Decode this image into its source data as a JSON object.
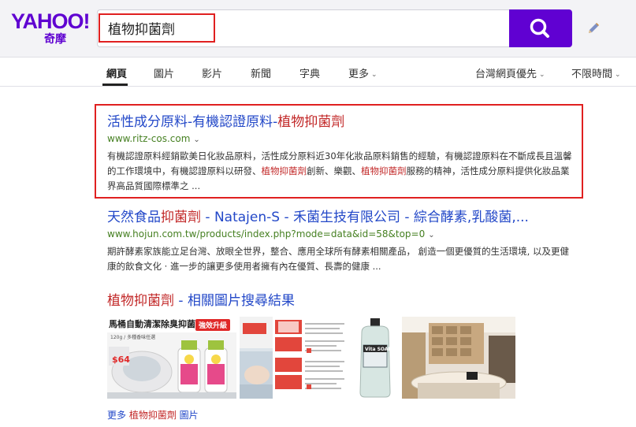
{
  "logo": {
    "main": "YAHOO!",
    "sub": "奇摩"
  },
  "search": {
    "query": "植物抑菌劑"
  },
  "tabs": [
    {
      "label": "網頁",
      "active": true
    },
    {
      "label": "圖片"
    },
    {
      "label": "影片"
    },
    {
      "label": "新聞"
    },
    {
      "label": "字典"
    },
    {
      "label": "更多"
    }
  ],
  "filters": {
    "region": "台灣網頁優先",
    "time": "不限時間"
  },
  "results": [
    {
      "title_pre": "活性成分原料-有機認證原料-",
      "title_hl": "植物抑菌劑",
      "url": "www.ritz-cos.com",
      "desc_1": "有機認證原料經銷歐美日化妝品原料，活性成分原料近30年化妝品原料銷售的經驗，有機認證原料在不斷成長且溫馨的工作環境中，有機認證原料以研發、",
      "desc_hl1": "植物抑菌劑",
      "desc_2": "創新、樂觀、",
      "desc_hl2": "植物抑菌劑",
      "desc_3": "服務的精神，活性成分原料提供化妝品業界高品質國際標準之 ..."
    },
    {
      "title_pre": "天然食品",
      "title_hl": "抑菌劑",
      "title_post": " - Natajen-S - 禾菌生技有限公司 - 綜合酵素,乳酸菌,...",
      "url": "www.hojun.com.tw/products/index.php?mode=data&id=58&top=0",
      "desc": "期許酵素家族能立足台灣、放眼全世界，整合、應用全球所有酵素相關產品， 創造一個更優質的生活環境, 以及更健康的飲食文化 · 進一步的讓更多使用者擁有內在優質、長壽的健康 ..."
    }
  ],
  "image_section": {
    "title_hl": "植物抑菌劑",
    "title_post": " - 相關圖片搜尋結果",
    "thumb1_text": "馬桶自動清潔除臭抑菌劑",
    "thumb1_badge": "強效升級",
    "thumb1_sub": "120g / 多種香味任選",
    "thumb1_price": "$64",
    "thumb4_label": "Vita SOAP",
    "more_pre": "更多 ",
    "more_hl": "植物抑菌劑",
    "more_post": " 圖片"
  }
}
